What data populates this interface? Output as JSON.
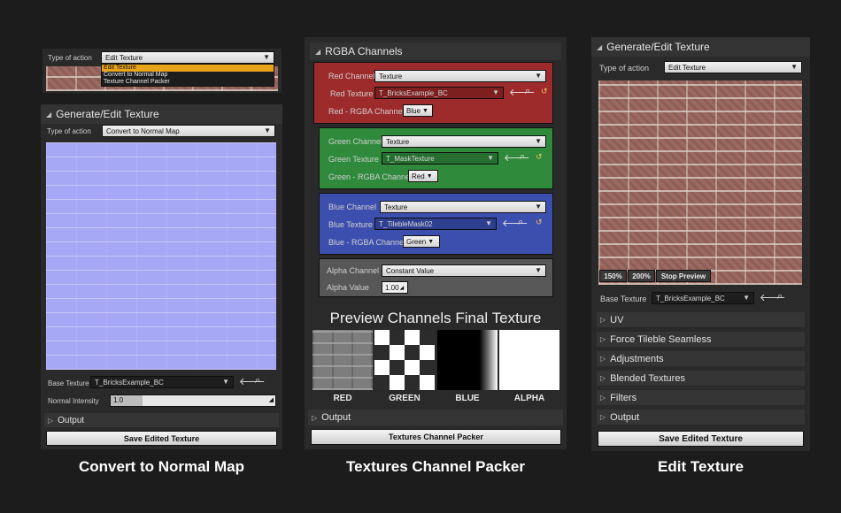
{
  "left": {
    "popup": {
      "type_label": "Type of action",
      "selected_value": "Edit Texture",
      "options": [
        "Edit Texture",
        "Convert to Normal Map",
        "Texture Channel Packer"
      ]
    },
    "header": "Generate/Edit Texture",
    "type_label": "Type of action",
    "type_value": "Convert to Normal Map",
    "base_texture_label": "Base Texture",
    "base_texture_value": "T_BricksExample_BC",
    "normal_intensity_label": "Normal Intensity",
    "normal_intensity_value": "1.0",
    "output_label": "Output",
    "save_label": "Save Edited Texture",
    "caption": "Convert to Normal Map"
  },
  "middle": {
    "header": "RGBA Channels",
    "red": {
      "channel_label": "Red Channel",
      "channel_value": "Texture",
      "texture_label": "Red Texture",
      "texture_value": "T_BricksExample_BC",
      "rgba_label": "Red - RGBA Channel",
      "rgba_value": "Blue",
      "color": "#9e2b2b"
    },
    "green": {
      "channel_label": "Green Channel",
      "channel_value": "Texture",
      "texture_label": "Green Texture",
      "texture_value": "T_MaskTexture",
      "rgba_label": "Green - RGBA Channel",
      "rgba_value": "Red",
      "color": "#2f8a3c"
    },
    "blue": {
      "channel_label": "Blue Channel",
      "channel_value": "Texture",
      "texture_label": "Blue Texture",
      "texture_value": "T_TilebleMask02",
      "rgba_label": "Blue - RGBA Channel",
      "rgba_value": "Green",
      "color": "#3d4fae"
    },
    "alpha": {
      "channel_label": "Alpha Channel",
      "channel_value": "Constant Value",
      "value_label": "Alpha Value",
      "value": "1.00",
      "color": "#575757"
    },
    "preview_title": "Preview Channels Final Texture",
    "preview_labels": [
      "RED",
      "GREEN",
      "BLUE",
      "ALPHA"
    ],
    "output_label": "Output",
    "packer_label": "Textures Channel Packer",
    "caption": "Textures Channel Packer"
  },
  "right": {
    "header": "Generate/Edit Texture",
    "type_label": "Type of action",
    "type_value": "Edit Texture",
    "zoom_buttons": [
      "150%",
      "200%",
      "Stop Preview"
    ],
    "base_texture_label": "Base Texture",
    "base_texture_value": "T_BricksExample_BC",
    "sections": [
      "UV",
      "Force Tileble Seamless",
      "Adjustments",
      "Blended Textures",
      "Filters",
      "Output"
    ],
    "save_label": "Save Edited Texture",
    "caption": "Edit Texture"
  }
}
